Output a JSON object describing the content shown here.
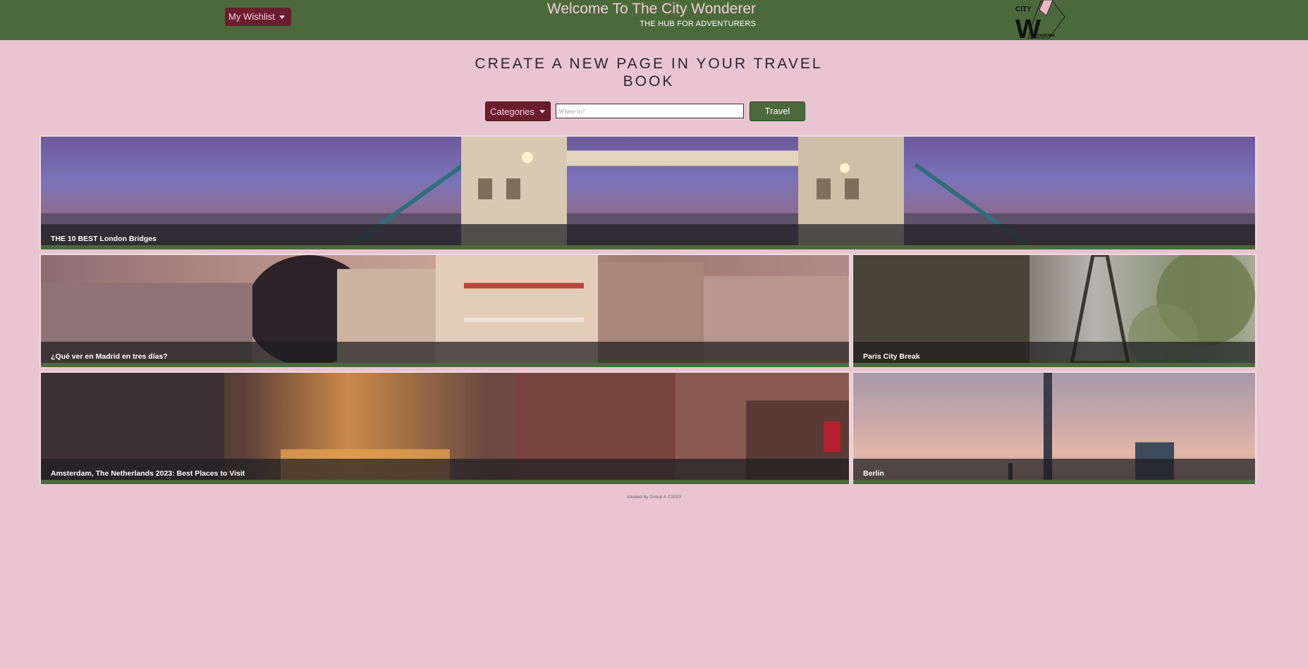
{
  "header": {
    "wishlist_label": "My Wishlist",
    "title": "Welcome To The City Wonderer",
    "subtitle": "THE HUB FOR ADVENTURERS",
    "logo": {
      "top_text": "CITY",
      "letter": "W",
      "bottom_text": "ONDERER"
    }
  },
  "main": {
    "heading_line1": "CREATE A NEW PAGE IN YOUR TRAVEL",
    "heading_line2": "BOOK",
    "categories_label": "Categories",
    "search_placeholder": "Where to?",
    "search_value": "",
    "travel_label": "Travel"
  },
  "cards": [
    {
      "caption": "THE 10 BEST London Bridges"
    },
    {
      "caption": "¿Qué ver en Madrid en tres días?"
    },
    {
      "caption": "Paris City Break"
    },
    {
      "caption": "Amsterdam, The Netherlands 2023: Best Places to Visit"
    },
    {
      "caption": "Berlin"
    }
  ],
  "footer": {
    "text": "created by Group 4 ©2023"
  },
  "colors": {
    "header_bg": "#4b6a3b",
    "page_bg": "#e9c5d1",
    "accent_maroon": "#6b1d2e",
    "title_pink": "#f3cdd9"
  }
}
